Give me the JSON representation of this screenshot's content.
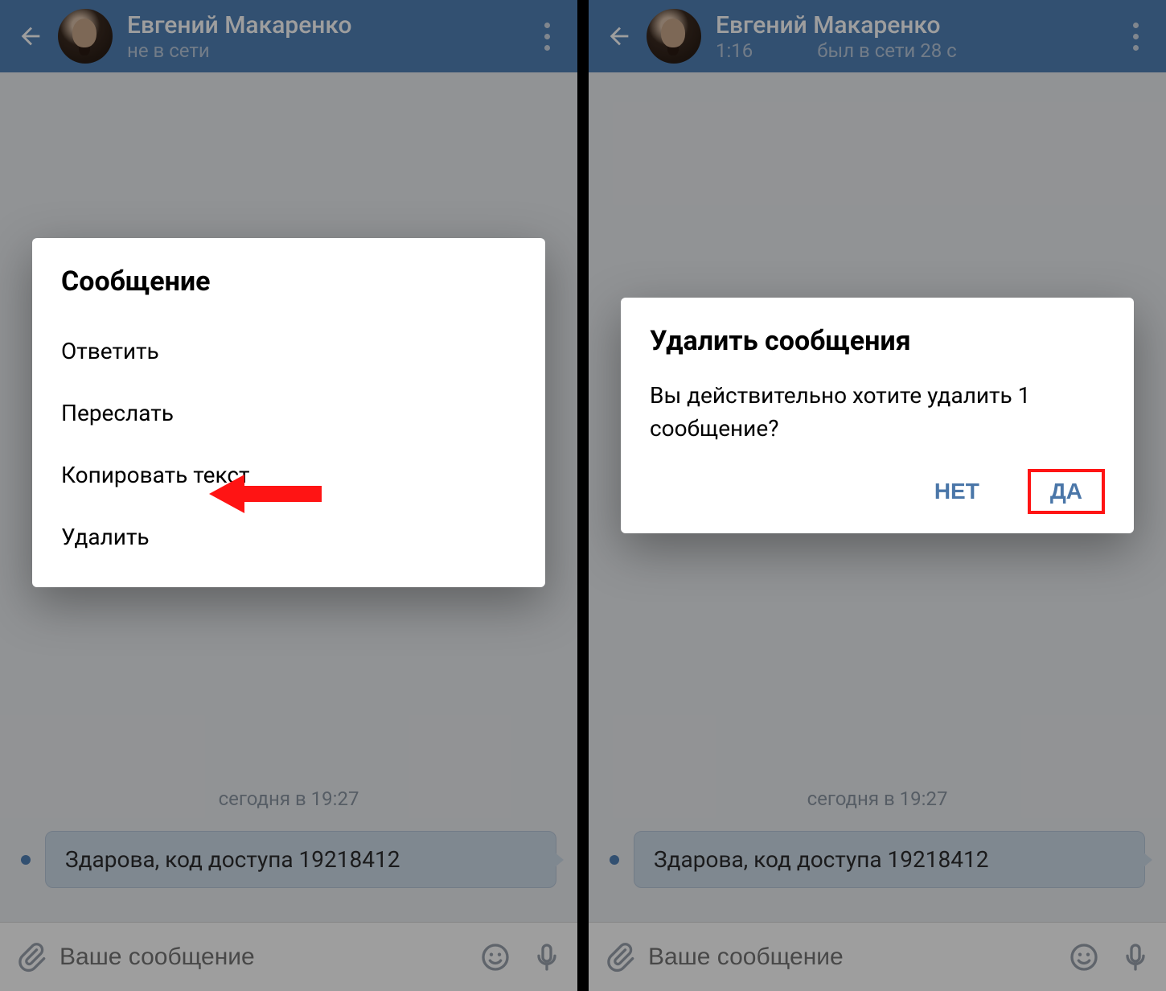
{
  "left": {
    "contact_name": "Евгений Макаренко",
    "status": "не в сети",
    "dialog": {
      "title": "Сообщение",
      "items": [
        "Ответить",
        "Переслать",
        "Копировать текст",
        "Удалить"
      ]
    },
    "timestamp": "сегодня в 19:27",
    "message": "Здарова, код доступа 19218412",
    "input_placeholder": "Ваше сообщение"
  },
  "right": {
    "contact_name": "Евгений Макаренко",
    "time": "1:16",
    "last_seen": "был в сети 28 с",
    "dialog": {
      "title": "Удалить сообщения",
      "body": "Вы действительно хотите удалить 1 сообщение?",
      "no": "НЕТ",
      "yes": "ДА"
    },
    "timestamp": "сегодня в 19:27",
    "message": "Здарова, код доступа 19218412",
    "input_placeholder": "Ваше сообщение"
  }
}
